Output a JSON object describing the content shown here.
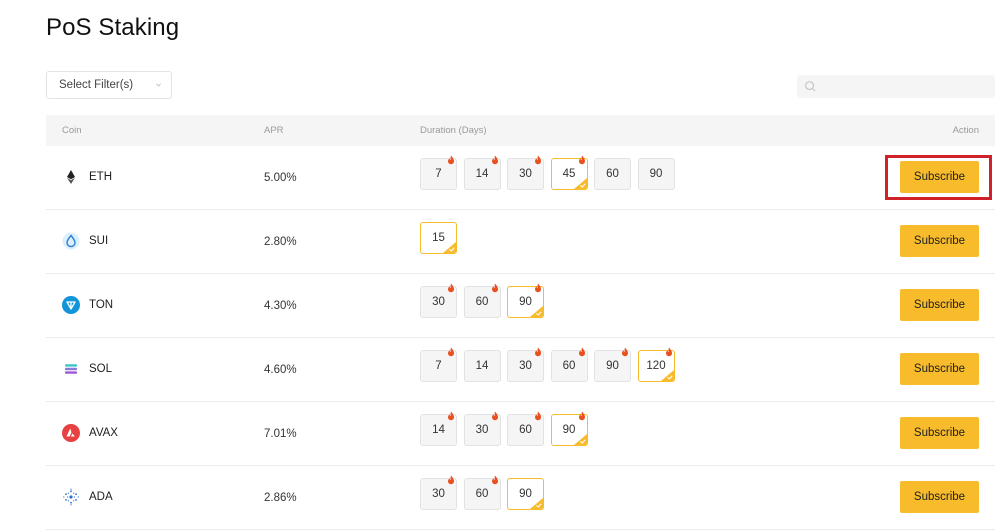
{
  "page": {
    "title": "PoS Staking"
  },
  "filter": {
    "placeholder": "Select Filter(s)"
  },
  "search": {
    "value": "",
    "placeholder": ""
  },
  "table": {
    "headers": {
      "coin": "Coin",
      "apr": "APR",
      "duration": "Duration (Days)",
      "action": "Action"
    },
    "rows": [
      {
        "coin": "ETH",
        "icon": "eth-icon",
        "apr": "5.00%",
        "action": "Subscribe",
        "durations": [
          {
            "days": "7",
            "hot": true,
            "selected": false
          },
          {
            "days": "14",
            "hot": true,
            "selected": false
          },
          {
            "days": "30",
            "hot": true,
            "selected": false
          },
          {
            "days": "45",
            "hot": true,
            "selected": true
          },
          {
            "days": "60",
            "hot": false,
            "selected": false
          },
          {
            "days": "90",
            "hot": false,
            "selected": false
          }
        ]
      },
      {
        "coin": "SUI",
        "icon": "sui-icon",
        "apr": "2.80%",
        "action": "Subscribe",
        "durations": [
          {
            "days": "15",
            "hot": false,
            "selected": true
          }
        ]
      },
      {
        "coin": "TON",
        "icon": "ton-icon",
        "apr": "4.30%",
        "action": "Subscribe",
        "durations": [
          {
            "days": "30",
            "hot": true,
            "selected": false
          },
          {
            "days": "60",
            "hot": true,
            "selected": false
          },
          {
            "days": "90",
            "hot": true,
            "selected": true
          }
        ]
      },
      {
        "coin": "SOL",
        "icon": "sol-icon",
        "apr": "4.60%",
        "action": "Subscribe",
        "durations": [
          {
            "days": "7",
            "hot": true,
            "selected": false
          },
          {
            "days": "14",
            "hot": false,
            "selected": false
          },
          {
            "days": "30",
            "hot": true,
            "selected": false
          },
          {
            "days": "60",
            "hot": true,
            "selected": false
          },
          {
            "days": "90",
            "hot": true,
            "selected": false
          },
          {
            "days": "120",
            "hot": true,
            "selected": true
          }
        ]
      },
      {
        "coin": "AVAX",
        "icon": "avax-icon",
        "apr": "7.01%",
        "action": "Subscribe",
        "durations": [
          {
            "days": "14",
            "hot": true,
            "selected": false
          },
          {
            "days": "30",
            "hot": true,
            "selected": false
          },
          {
            "days": "60",
            "hot": true,
            "selected": false
          },
          {
            "days": "90",
            "hot": true,
            "selected": true
          }
        ]
      },
      {
        "coin": "ADA",
        "icon": "ada-icon",
        "apr": "2.86%",
        "action": "Subscribe",
        "durations": [
          {
            "days": "30",
            "hot": true,
            "selected": false
          },
          {
            "days": "60",
            "hot": true,
            "selected": false
          },
          {
            "days": "90",
            "hot": false,
            "selected": true
          }
        ]
      }
    ]
  },
  "colors": {
    "accent": "#f7bb2c",
    "highlight": "#d0202a",
    "flame": "#e8501f",
    "header_bg": "#f5f5f5"
  }
}
